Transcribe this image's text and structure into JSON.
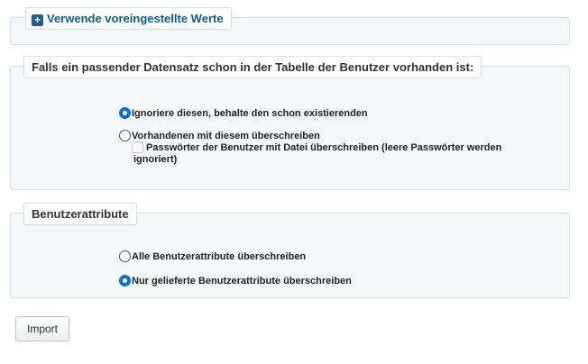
{
  "defaults_section": {
    "legend": "Verwende voreingestellte Werte",
    "icon": "plus-square-icon"
  },
  "duplicate_section": {
    "legend": "Falls ein passender Datensatz schon in der Tabelle der Benutzer vorhanden ist:",
    "options": [
      {
        "label": "Ignoriere diesen, behalte den schon existierenden",
        "selected": true
      },
      {
        "label": "Vorhandenen mit diesem überschreiben",
        "selected": false
      }
    ],
    "checkbox": {
      "label_line1": "Passwörter der Benutzer mit Datei überschreiben (leere Passwörter werden",
      "label_line2": "ignoriert)",
      "checked": false
    }
  },
  "attributes_section": {
    "legend": "Benutzerattribute",
    "options": [
      {
        "label": "Alle Benutzerattribute überschreiben",
        "selected": false
      },
      {
        "label": "Nur gelieferte Benutzerattribute überschreiben",
        "selected": true
      }
    ]
  },
  "import_button": {
    "label": "Import"
  },
  "colors": {
    "accent": "#0a6fd6",
    "link": "#0a5e8c",
    "panel_bg": "#f4f8f9",
    "border": "#cfe0e3"
  }
}
